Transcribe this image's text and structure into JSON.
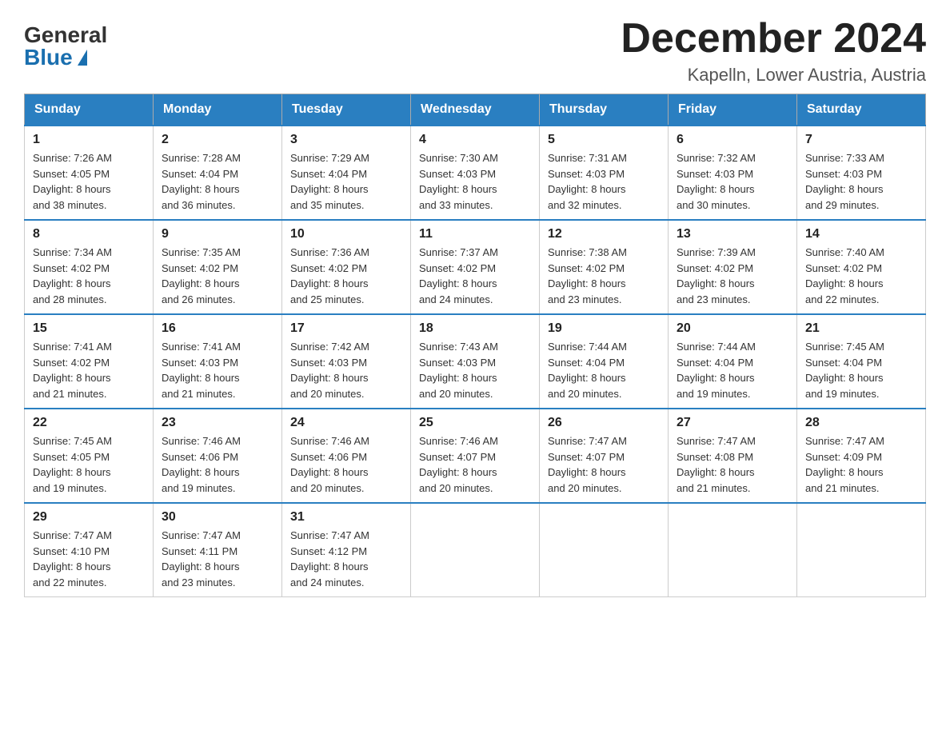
{
  "header": {
    "logo_general": "General",
    "logo_blue": "Blue",
    "month_title": "December 2024",
    "location": "Kapelln, Lower Austria, Austria"
  },
  "days_of_week": [
    "Sunday",
    "Monday",
    "Tuesday",
    "Wednesday",
    "Thursday",
    "Friday",
    "Saturday"
  ],
  "weeks": [
    [
      {
        "day": "1",
        "sunrise": "7:26 AM",
        "sunset": "4:05 PM",
        "daylight": "8 hours and 38 minutes."
      },
      {
        "day": "2",
        "sunrise": "7:28 AM",
        "sunset": "4:04 PM",
        "daylight": "8 hours and 36 minutes."
      },
      {
        "day": "3",
        "sunrise": "7:29 AM",
        "sunset": "4:04 PM",
        "daylight": "8 hours and 35 minutes."
      },
      {
        "day": "4",
        "sunrise": "7:30 AM",
        "sunset": "4:03 PM",
        "daylight": "8 hours and 33 minutes."
      },
      {
        "day": "5",
        "sunrise": "7:31 AM",
        "sunset": "4:03 PM",
        "daylight": "8 hours and 32 minutes."
      },
      {
        "day": "6",
        "sunrise": "7:32 AM",
        "sunset": "4:03 PM",
        "daylight": "8 hours and 30 minutes."
      },
      {
        "day": "7",
        "sunrise": "7:33 AM",
        "sunset": "4:03 PM",
        "daylight": "8 hours and 29 minutes."
      }
    ],
    [
      {
        "day": "8",
        "sunrise": "7:34 AM",
        "sunset": "4:02 PM",
        "daylight": "8 hours and 28 minutes."
      },
      {
        "day": "9",
        "sunrise": "7:35 AM",
        "sunset": "4:02 PM",
        "daylight": "8 hours and 26 minutes."
      },
      {
        "day": "10",
        "sunrise": "7:36 AM",
        "sunset": "4:02 PM",
        "daylight": "8 hours and 25 minutes."
      },
      {
        "day": "11",
        "sunrise": "7:37 AM",
        "sunset": "4:02 PM",
        "daylight": "8 hours and 24 minutes."
      },
      {
        "day": "12",
        "sunrise": "7:38 AM",
        "sunset": "4:02 PM",
        "daylight": "8 hours and 23 minutes."
      },
      {
        "day": "13",
        "sunrise": "7:39 AM",
        "sunset": "4:02 PM",
        "daylight": "8 hours and 23 minutes."
      },
      {
        "day": "14",
        "sunrise": "7:40 AM",
        "sunset": "4:02 PM",
        "daylight": "8 hours and 22 minutes."
      }
    ],
    [
      {
        "day": "15",
        "sunrise": "7:41 AM",
        "sunset": "4:02 PM",
        "daylight": "8 hours and 21 minutes."
      },
      {
        "day": "16",
        "sunrise": "7:41 AM",
        "sunset": "4:03 PM",
        "daylight": "8 hours and 21 minutes."
      },
      {
        "day": "17",
        "sunrise": "7:42 AM",
        "sunset": "4:03 PM",
        "daylight": "8 hours and 20 minutes."
      },
      {
        "day": "18",
        "sunrise": "7:43 AM",
        "sunset": "4:03 PM",
        "daylight": "8 hours and 20 minutes."
      },
      {
        "day": "19",
        "sunrise": "7:44 AM",
        "sunset": "4:04 PM",
        "daylight": "8 hours and 20 minutes."
      },
      {
        "day": "20",
        "sunrise": "7:44 AM",
        "sunset": "4:04 PM",
        "daylight": "8 hours and 19 minutes."
      },
      {
        "day": "21",
        "sunrise": "7:45 AM",
        "sunset": "4:04 PM",
        "daylight": "8 hours and 19 minutes."
      }
    ],
    [
      {
        "day": "22",
        "sunrise": "7:45 AM",
        "sunset": "4:05 PM",
        "daylight": "8 hours and 19 minutes."
      },
      {
        "day": "23",
        "sunrise": "7:46 AM",
        "sunset": "4:06 PM",
        "daylight": "8 hours and 19 minutes."
      },
      {
        "day": "24",
        "sunrise": "7:46 AM",
        "sunset": "4:06 PM",
        "daylight": "8 hours and 20 minutes."
      },
      {
        "day": "25",
        "sunrise": "7:46 AM",
        "sunset": "4:07 PM",
        "daylight": "8 hours and 20 minutes."
      },
      {
        "day": "26",
        "sunrise": "7:47 AM",
        "sunset": "4:07 PM",
        "daylight": "8 hours and 20 minutes."
      },
      {
        "day": "27",
        "sunrise": "7:47 AM",
        "sunset": "4:08 PM",
        "daylight": "8 hours and 21 minutes."
      },
      {
        "day": "28",
        "sunrise": "7:47 AM",
        "sunset": "4:09 PM",
        "daylight": "8 hours and 21 minutes."
      }
    ],
    [
      {
        "day": "29",
        "sunrise": "7:47 AM",
        "sunset": "4:10 PM",
        "daylight": "8 hours and 22 minutes."
      },
      {
        "day": "30",
        "sunrise": "7:47 AM",
        "sunset": "4:11 PM",
        "daylight": "8 hours and 23 minutes."
      },
      {
        "day": "31",
        "sunrise": "7:47 AM",
        "sunset": "4:12 PM",
        "daylight": "8 hours and 24 minutes."
      },
      null,
      null,
      null,
      null
    ]
  ],
  "labels": {
    "sunrise": "Sunrise:",
    "sunset": "Sunset:",
    "daylight": "Daylight:"
  }
}
